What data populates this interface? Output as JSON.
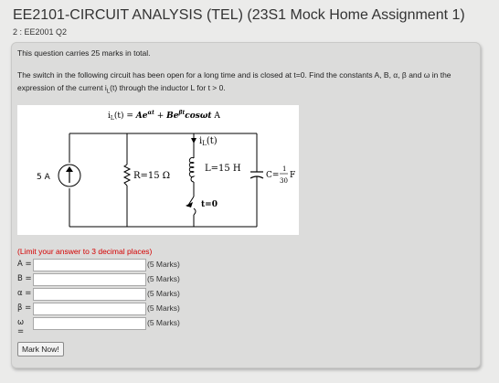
{
  "header": {
    "title": "EE2101-CIRCUIT ANALYSIS (TEL) (23S1 Mock Home Assignment 1)",
    "subtitle": "2 : EE2001 Q2"
  },
  "question": {
    "marks_note": "This question carries 25 marks in total.",
    "line1": "The switch in the following circuit has been open for a long time and is closed at t=0. Find the constants A, B, α, β and ω in the",
    "line2_a": "expression of the current i",
    "line2_sub": "L",
    "line2_b": "(t) through the inductor L for t > 0."
  },
  "circuit": {
    "equation_lhs": "i",
    "equation_lhs_sub": "L",
    "equation_lhs_rest": "(t) = ",
    "equation_term1": "Ae",
    "equation_term1_exp": "αt",
    "equation_plus": " + ",
    "equation_term2": "Be",
    "equation_term2_exp": "βt",
    "equation_term2_rest": "cosωt",
    "equation_unit": " A",
    "source_label": "5 A",
    "resistor_label": "R=15 Ω",
    "current_label": "i",
    "current_label_sub": "L",
    "current_label_rest": "(t)",
    "inductor_label": "L=15 H",
    "capacitor_prefix": "C=",
    "capacitor_num": "1",
    "capacitor_den": "30",
    "capacitor_unit": "F",
    "switch_label": "t=0"
  },
  "form": {
    "limit_note": "(Limit your answer to 3 decimal places)",
    "rows": [
      {
        "label": "A =",
        "value": "",
        "marks": "(5 Marks)"
      },
      {
        "label": "B =",
        "value": "",
        "marks": "(5 Marks)"
      },
      {
        "label": "α =",
        "value": "",
        "marks": "(5 Marks)"
      },
      {
        "label": "β =",
        "value": "",
        "marks": "(5 Marks)"
      },
      {
        "label": "ω =",
        "value": "",
        "marks": "(5 Marks)"
      }
    ],
    "submit_label": "Mark Now!"
  },
  "colors": {
    "accent_red": "#d40000",
    "panel": "#dcdcdb",
    "background": "#ebebea"
  }
}
